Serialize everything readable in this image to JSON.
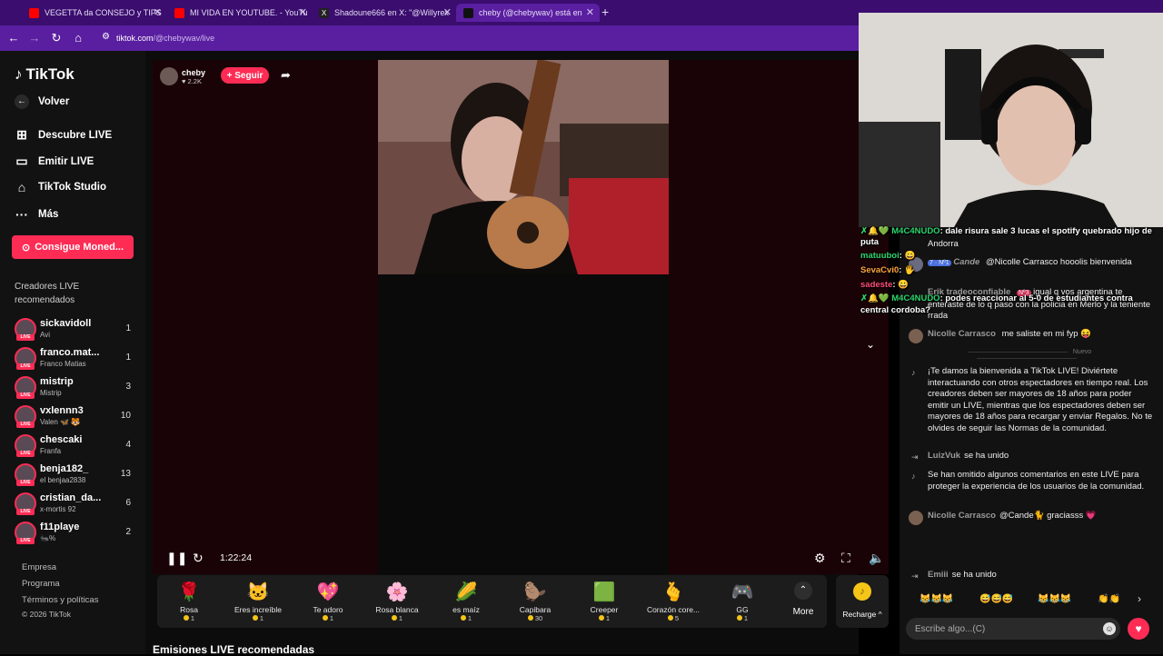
{
  "browser": {
    "tabs": [
      {
        "title": "VEGETTA da CONSEJO y TIPS p",
        "icon_color": "#ff0000"
      },
      {
        "title": "MI VIDA EN YOUTUBE. - YouTu",
        "icon_color": "#ff0000"
      },
      {
        "title": "Shadoune666 en X: \"@Willyrex",
        "icon_color": "#222222"
      },
      {
        "title": "cheby (@chebywav) está en",
        "icon_color": "#111111"
      }
    ],
    "url_host": "tiktok.com",
    "url_path": "/@chebywav/live"
  },
  "sidebar": {
    "logo": "TikTok",
    "nav": [
      {
        "label": "Volver",
        "icon": "arrow-left-icon"
      },
      {
        "label": "Descubre LIVE",
        "icon": "compass-icon"
      },
      {
        "label": "Emitir LIVE",
        "icon": "camera-icon"
      },
      {
        "label": "TikTok Studio",
        "icon": "house-icon"
      },
      {
        "label": "Más",
        "icon": "dots-icon"
      }
    ],
    "coins_button": "Consigue Moned...",
    "creators_title": "Creadores LIVE recomendados",
    "live_badge": "LIVE",
    "creators": [
      {
        "name": "sickavidoll",
        "sub": "Avi",
        "count": "1"
      },
      {
        "name": "franco.mat...",
        "sub": "Franco Matias",
        "count": "1"
      },
      {
        "name": "mistrip",
        "sub": "Mistrip",
        "count": "3"
      },
      {
        "name": "vxlennn3",
        "sub": "Valen 🦋 🐯",
        "count": "10"
      },
      {
        "name": "chescaki",
        "sub": "Franfa",
        "count": "4"
      },
      {
        "name": "benja182_",
        "sub": "el benjaa2838",
        "count": "13"
      },
      {
        "name": "cristian_da...",
        "sub": "x-mortis 92",
        "count": "6"
      },
      {
        "name": "f11playe",
        "sub": "🐜%",
        "count": "2"
      }
    ],
    "footer": [
      "Empresa",
      "Programa",
      "Términos y políticas",
      "© 2026 TikTok"
    ]
  },
  "live": {
    "host_name": "cheby",
    "host_likes": "♥ 2.2K",
    "follow_label": "+ Seguir",
    "timer": "1:22:24"
  },
  "gifts": [
    {
      "name": "Rosa",
      "price": "1",
      "icon": "🌹"
    },
    {
      "name": "Eres increíble",
      "price": "1",
      "icon": "🐱"
    },
    {
      "name": "Te adoro",
      "price": "1",
      "icon": "💖"
    },
    {
      "name": "Rosa blanca",
      "price": "1",
      "icon": "🌸"
    },
    {
      "name": "es maíz",
      "price": "1",
      "icon": "🌽"
    },
    {
      "name": "Capibara",
      "price": "30",
      "icon": "🦫"
    },
    {
      "name": "Creeper",
      "price": "1",
      "icon": "🟩"
    },
    {
      "name": "Corazón core...",
      "price": "5",
      "icon": "🫰"
    },
    {
      "name": "GG",
      "price": "1",
      "icon": "🎮"
    }
  ],
  "more_label": "More",
  "recharge_label": "Recharge ^",
  "recs_title": "Emisiones LIVE recomendadas",
  "overlay": [
    {
      "user": "✗🔔💚 M4C4NUDO",
      "text": ": dale risura sale 3 lucas el spotify quebrado hijo de"
    },
    {
      "user": "",
      "text": "puta"
    },
    {
      "user": "matuuboi",
      "text": ": 😀"
    },
    {
      "user": "SevaCvi0",
      "text": ": 🖐"
    },
    {
      "user": "sadeste",
      "text": ": 😀"
    },
    {
      "user": "✗🔔💚 M4C4NUDO",
      "text": ": podes reaccionar al 5-0 de estudiantes contra"
    },
    {
      "user": "",
      "text": "central cordoba?"
    }
  ],
  "chat": {
    "messages": [
      {
        "user": "",
        "text": "Andorra"
      },
      {
        "user": "Cande",
        "text": "@Nicolle Carrasco hooolis bienvenida",
        "badges": "7 · Nº1"
      },
      {
        "user": "Erik tradeoconfiable",
        "text": "igual q vos argentina te enteraste de lo q paso con la policia en Merlo y la teniente rrada",
        "badges": "Nº3"
      },
      {
        "user": "Nicolle Carrasco",
        "text": "me saliste en mi fyp 😝"
      }
    ],
    "nuevo": "Nuevo",
    "system_welcome": "¡Te damos la bienvenida a TikTok LIVE! Diviértete interactuando con otros espectadores en tiempo real. Los creadores deben ser mayores de 18 años para poder emitir un LIVE, mientras que los espectadores deben ser mayores de 18 años para recargar y enviar Regalos. No te olvides de seguir las Normas de la comunidad.",
    "join1_user": "LuizVuk",
    "join_text": "se ha unido",
    "system_omitted": "Se han omitido algunos comentarios en este LIVE para proteger la experiencia de los usuarios de la comunidad.",
    "last_user": "Nicolle Carrasco",
    "last_text": "@Cande🐈 graciasss 💗",
    "join2_user": "Emiii",
    "quick_replies": [
      "😹😹😹",
      "😅😅😅",
      "😹😹😹",
      "👏👏"
    ],
    "input_placeholder": "Escribe algo...(C)"
  }
}
